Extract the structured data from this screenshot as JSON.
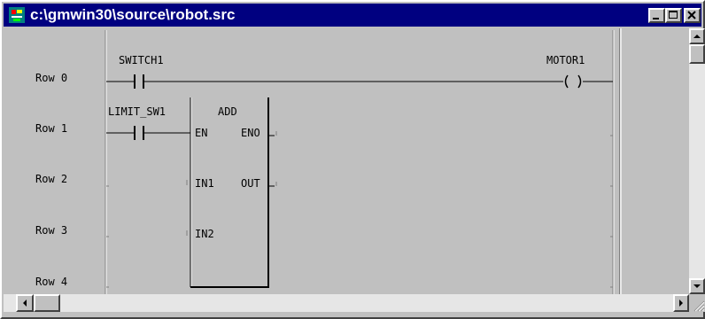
{
  "window": {
    "title": "c:\\gmwin30\\source\\robot.src",
    "title_bar_color": "#000080",
    "face_color": "#c0c0c0"
  },
  "title_buttons": [
    {
      "name": "minimize",
      "icon": "minimize-icon"
    },
    {
      "name": "maximize",
      "icon": "maximize-icon"
    },
    {
      "name": "close",
      "icon": "close-icon"
    }
  ],
  "rows": [
    "Row 0",
    "Row 1",
    "Row 2",
    "Row 3",
    "Row 4"
  ],
  "ladder": {
    "contact_row0": "SWITCH1",
    "coil_row0": "MOTOR1",
    "contact_row1": "LIMIT_SW1",
    "block": {
      "name": "ADD",
      "inputs": [
        "EN",
        "IN1",
        "IN2"
      ],
      "outputs": [
        "ENO",
        "OUT"
      ]
    }
  },
  "icons": {
    "app": "ladder-app-icon",
    "scroll_up": "arrow-up-icon",
    "scroll_down": "arrow-down-icon",
    "scroll_left": "arrow-left-icon",
    "scroll_right": "arrow-right-icon",
    "resize": "resize-grip-icon"
  }
}
